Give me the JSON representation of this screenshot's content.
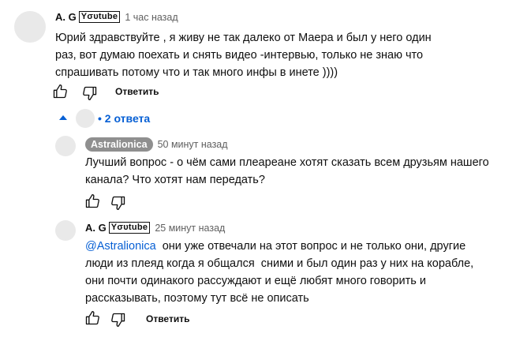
{
  "comment": {
    "author": "A. G",
    "badge": "Yσυtube",
    "time": "1 час назад",
    "text": "Юрий здравствуйте , я живу не так далеко от Маера и был у него один раз, вот думаю поехать и снять видео -интервью, только не знаю что спрашивать потому что и так много инфы в инете ))))",
    "reply_label": "Ответить",
    "replies_toggle": "• 2 ответа"
  },
  "replies": [
    {
      "author": "Astralionica",
      "time": "50 минут назад",
      "text": "Лучший вопрос - о чём сами плеареане хотят сказать всем друзьям нашего канала? Что хотят нам передать?"
    },
    {
      "author": "A. G",
      "badge": "Yσυtube",
      "time": "25 минут назад",
      "mention": "@Astralionica",
      "text": "  они уже отвечали на этот вопрос и не только они, другие люди из плеяд когда я общался  сними и был один раз у них на корабле, они почти одинакого рассуждают и ещё любят много говорить и рассказывать, поэтому тут всё не описать",
      "reply_label": "Ответить"
    }
  ],
  "icons": [
    "thumb-up-icon",
    "thumb-down-icon",
    "caret-up-icon"
  ]
}
